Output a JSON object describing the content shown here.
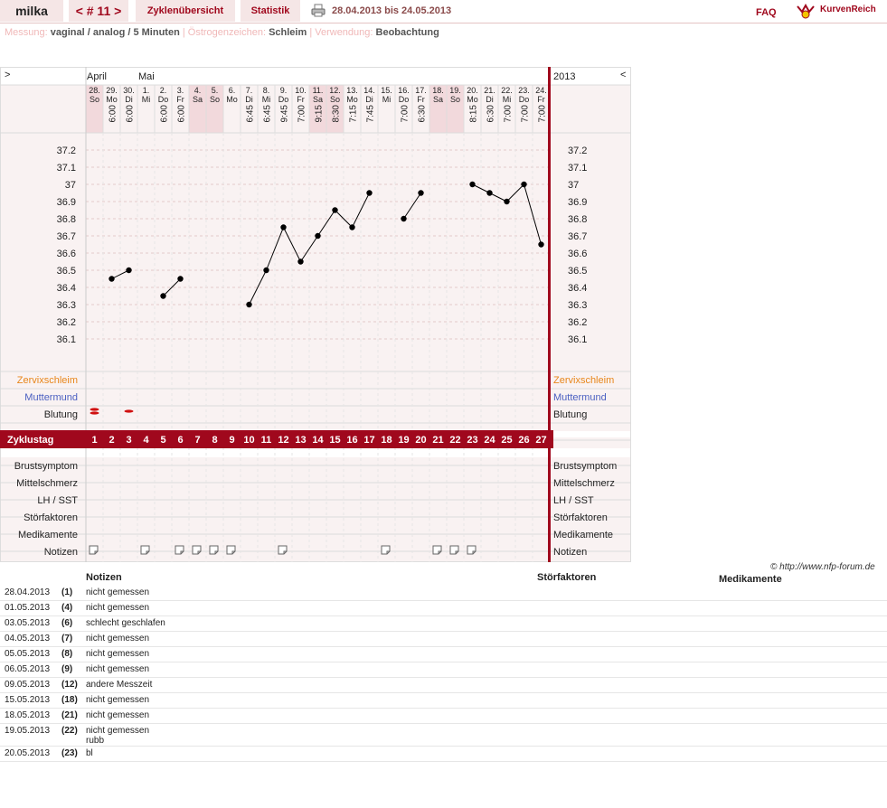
{
  "header": {
    "user": "milka",
    "cycle_nav": "< # 11 >",
    "tab_cycles": "Zyklenübersicht",
    "tab_stats": "Statistik",
    "date_range": "28.04.2013 bis 24.05.2013",
    "faq": "FAQ",
    "logo": "KurvenReich"
  },
  "measurement": {
    "messung_label": "Messung:",
    "messung_value": "vaginal / analog / 5 Minuten",
    "oestrogen_label": "Östrogenzeichen:",
    "oestrogen_value": "Schleim",
    "verwendung_label": "Verwendung:",
    "verwendung_value": "Beobachtung"
  },
  "chart_header": {
    "left_arrow": ">",
    "right_arrow": "<",
    "year": "2013",
    "month1": "April",
    "month2": "Mai"
  },
  "chart_data": {
    "type": "line",
    "title": "",
    "xlabel": "",
    "ylabel": "",
    "ylim": [
      36.0,
      37.3
    ],
    "y_ticks": [
      "37.2",
      "37.1",
      "37",
      "36.9",
      "36.8",
      "36.7",
      "36.6",
      "36.5",
      "36.4",
      "36.3",
      "36.2",
      "36.1"
    ],
    "days": [
      {
        "date": "28.",
        "wd": "So",
        "time": "",
        "temp": null,
        "we": true
      },
      {
        "date": "29.",
        "wd": "Mo",
        "time": "6:00",
        "temp": 36.45,
        "we": false
      },
      {
        "date": "30.",
        "wd": "Di",
        "time": "6:00",
        "temp": 36.5,
        "we": false
      },
      {
        "date": "1.",
        "wd": "Mi",
        "time": "",
        "temp": null,
        "we": false
      },
      {
        "date": "2.",
        "wd": "Do",
        "time": "6:00",
        "temp": 36.35,
        "we": false
      },
      {
        "date": "3.",
        "wd": "Fr",
        "time": "6:00",
        "temp": 36.45,
        "we": false
      },
      {
        "date": "4.",
        "wd": "Sa",
        "time": "",
        "temp": null,
        "we": true
      },
      {
        "date": "5.",
        "wd": "So",
        "time": "",
        "temp": null,
        "we": true
      },
      {
        "date": "6.",
        "wd": "Mo",
        "time": "",
        "temp": null,
        "we": false
      },
      {
        "date": "7.",
        "wd": "Di",
        "time": "6:45",
        "temp": 36.3,
        "we": false
      },
      {
        "date": "8.",
        "wd": "Mi",
        "time": "6:45",
        "temp": 36.5,
        "we": false
      },
      {
        "date": "9.",
        "wd": "Do",
        "time": "9:45",
        "temp": 36.75,
        "we": false
      },
      {
        "date": "10.",
        "wd": "Fr",
        "time": "7:00",
        "temp": 36.55,
        "we": false
      },
      {
        "date": "11.",
        "wd": "Sa",
        "time": "9:15",
        "temp": 36.7,
        "we": true
      },
      {
        "date": "12.",
        "wd": "So",
        "time": "8:30",
        "temp": 36.85,
        "we": true
      },
      {
        "date": "13.",
        "wd": "Mo",
        "time": "7:15",
        "temp": 36.75,
        "we": false
      },
      {
        "date": "14.",
        "wd": "Di",
        "time": "7:45",
        "temp": 36.95,
        "we": false
      },
      {
        "date": "15.",
        "wd": "Mi",
        "time": "",
        "temp": null,
        "we": false
      },
      {
        "date": "16.",
        "wd": "Do",
        "time": "7:00",
        "temp": 36.8,
        "we": false
      },
      {
        "date": "17.",
        "wd": "Fr",
        "time": "6:30",
        "temp": 36.95,
        "we": false
      },
      {
        "date": "18.",
        "wd": "Sa",
        "time": "",
        "temp": null,
        "we": true
      },
      {
        "date": "19.",
        "wd": "So",
        "time": "",
        "temp": null,
        "we": true
      },
      {
        "date": "20.",
        "wd": "Mo",
        "time": "8:15",
        "temp": 37.0,
        "we": false
      },
      {
        "date": "21.",
        "wd": "Di",
        "time": "6:30",
        "temp": 36.95,
        "we": false
      },
      {
        "date": "22.",
        "wd": "Mi",
        "time": "7:00",
        "temp": 36.9,
        "we": false
      },
      {
        "date": "23.",
        "wd": "Do",
        "time": "7:00",
        "temp": 37.0,
        "we": false
      },
      {
        "date": "24.",
        "wd": "Fr",
        "time": "7:00",
        "temp": 36.65,
        "we": false
      }
    ],
    "bleeding_days": [
      1,
      3
    ],
    "note_days": [
      1,
      4,
      6,
      7,
      8,
      9,
      12,
      18,
      21,
      22,
      23
    ],
    "cycle_days": [
      "1",
      "2",
      "3",
      "4",
      "5",
      "6",
      "7",
      "8",
      "9",
      "10",
      "11",
      "12",
      "13",
      "14",
      "15",
      "16",
      "17",
      "18",
      "19",
      "20",
      "21",
      "22",
      "23",
      "24",
      "25",
      "26",
      "27"
    ]
  },
  "rows": {
    "zervix": "Zervixschleim",
    "muttermund": "Muttermund",
    "blutung": "Blutung",
    "zyklustag": "Zyklustag",
    "brust": "Brustsymptom",
    "mittel": "Mittelschmerz",
    "lhsst": "LH / SST",
    "stoer": "Störfaktoren",
    "medi": "Medikamente",
    "notizen": "Notizen"
  },
  "colors": {
    "brand": "#a0081d",
    "zervix": "#e8861a",
    "muttermund": "#4a5fc1"
  },
  "copyright": "© http://www.nfp-forum.de",
  "notes_table": {
    "headers": {
      "notes": "Notizen",
      "stoer": "Störfaktoren",
      "medi": "Medikamente"
    },
    "rows": [
      {
        "date": "28.04.2013",
        "cd": "(1)",
        "note": "nicht gemessen"
      },
      {
        "date": "01.05.2013",
        "cd": "(4)",
        "note": "nicht gemessen"
      },
      {
        "date": "03.05.2013",
        "cd": "(6)",
        "note": "schlecht geschlafen"
      },
      {
        "date": "04.05.2013",
        "cd": "(7)",
        "note": "nicht gemessen"
      },
      {
        "date": "05.05.2013",
        "cd": "(8)",
        "note": "nicht gemessen"
      },
      {
        "date": "06.05.2013",
        "cd": "(9)",
        "note": "nicht gemessen"
      },
      {
        "date": "09.05.2013",
        "cd": "(12)",
        "note": "andere Messzeit"
      },
      {
        "date": "15.05.2013",
        "cd": "(18)",
        "note": "nicht gemessen"
      },
      {
        "date": "18.05.2013",
        "cd": "(21)",
        "note": "nicht gemessen"
      },
      {
        "date": "19.05.2013",
        "cd": "(22)",
        "note": "nicht gemessen\nrubb"
      },
      {
        "date": "20.05.2013",
        "cd": "(23)",
        "note": "bl"
      }
    ]
  }
}
